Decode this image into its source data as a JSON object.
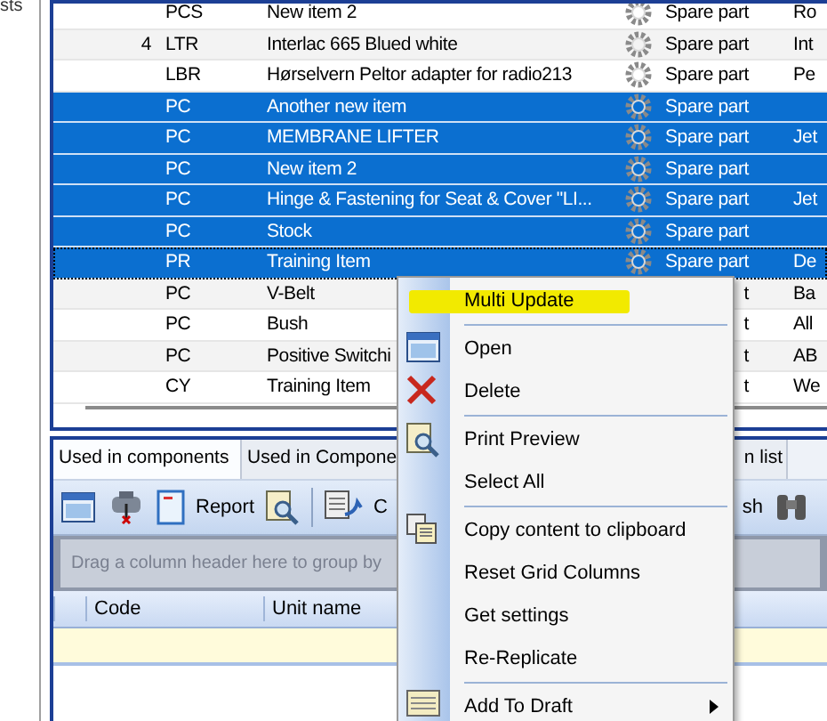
{
  "left_panel": {
    "text": "sts"
  },
  "grid": {
    "rows": [
      {
        "unit": "PCS",
        "name": "New item 2",
        "icon": true,
        "type": "Spare part",
        "column_6": "Ro",
        "selected": false,
        "focused": false
      },
      {
        "number": "4",
        "unit": "LTR",
        "name": "Interlac 665 Blued white",
        "icon": true,
        "type": "Spare part",
        "column_6": "Int",
        "selected": false,
        "focused": false
      },
      {
        "unit": "LBR",
        "name": "Hørselvern Peltor adapter for radio213",
        "icon": true,
        "type": "Spare part",
        "column_6": "Pe",
        "selected": false,
        "focused": false
      },
      {
        "unit": "PC",
        "name": "Another new item",
        "icon": true,
        "type": "Spare part",
        "selected": true,
        "focused": false
      },
      {
        "unit": "PC",
        "name": "MEMBRANE LIFTER",
        "icon": true,
        "type": "Spare part",
        "column_6": "Jet",
        "selected": true,
        "focused": false
      },
      {
        "unit": "PC",
        "name": "New item 2",
        "icon": true,
        "type": "Spare part",
        "selected": true,
        "focused": false
      },
      {
        "unit": "PC",
        "name": "Hinge & Fastening for Seat & Cover \"LI...",
        "icon": true,
        "type": "Spare part",
        "column_6": "Jet",
        "selected": true,
        "focused": false
      },
      {
        "unit": "PC",
        "name": "Stock",
        "icon": true,
        "type": "Spare part",
        "selected": true,
        "focused": false
      },
      {
        "unit": "PR",
        "name": "Training Item",
        "icon": true,
        "type": "Spare part",
        "column_6": "De",
        "selected": true,
        "focused": true
      },
      {
        "unit": "PC",
        "name": "V-Belt",
        "icon": false,
        "type": "t",
        "column_6": "Ba",
        "selected": false,
        "focused": false
      },
      {
        "unit": "PC",
        "name": "Bush",
        "icon": false,
        "type": "t",
        "column_6": "All",
        "selected": false,
        "focused": false
      },
      {
        "unit": "PC",
        "name": "Positive Switchi",
        "icon": false,
        "type": "t",
        "column_6": "AB",
        "selected": false,
        "focused": false
      },
      {
        "unit": "CY",
        "name": "Training Item",
        "icon": false,
        "type": "t",
        "column_6": "We",
        "selected": false,
        "focused": false
      }
    ]
  },
  "bottom_panel": {
    "tabs": [
      {
        "label": "Used in components",
        "selected": true
      },
      {
        "label": "Used in Compone",
        "selected": false
      },
      {
        "label": "n list",
        "selected": false
      }
    ],
    "toolbar": {
      "buttons": [
        "Report",
        "C",
        "sh"
      ]
    },
    "group_by_hint": "Drag a column header here to group by",
    "columns": [
      "Code",
      "Unit name"
    ]
  },
  "context_menu": {
    "items": [
      {
        "label": "Multi Update",
        "highlighted": true,
        "submenu": false,
        "separator_after": true
      },
      {
        "label": "Open",
        "highlighted": false,
        "submenu": false,
        "separator_after": false
      },
      {
        "label": "Delete",
        "highlighted": false,
        "submenu": false,
        "separator_after": true
      },
      {
        "label": "Print Preview",
        "highlighted": false,
        "submenu": false,
        "separator_after": false
      },
      {
        "label": "Select All",
        "highlighted": false,
        "submenu": false,
        "separator_after": true
      },
      {
        "label": "Copy content to clipboard",
        "highlighted": false,
        "submenu": false,
        "separator_after": false
      },
      {
        "label": "Reset Grid Columns",
        "highlighted": false,
        "submenu": false,
        "separator_after": false
      },
      {
        "label": "Get settings",
        "highlighted": false,
        "submenu": false,
        "separator_after": false
      },
      {
        "label": "Re-Replicate",
        "highlighted": false,
        "submenu": false,
        "separator_after": true
      },
      {
        "label": "Add To Draft",
        "highlighted": false,
        "submenu": true,
        "separator_after": false
      }
    ]
  }
}
